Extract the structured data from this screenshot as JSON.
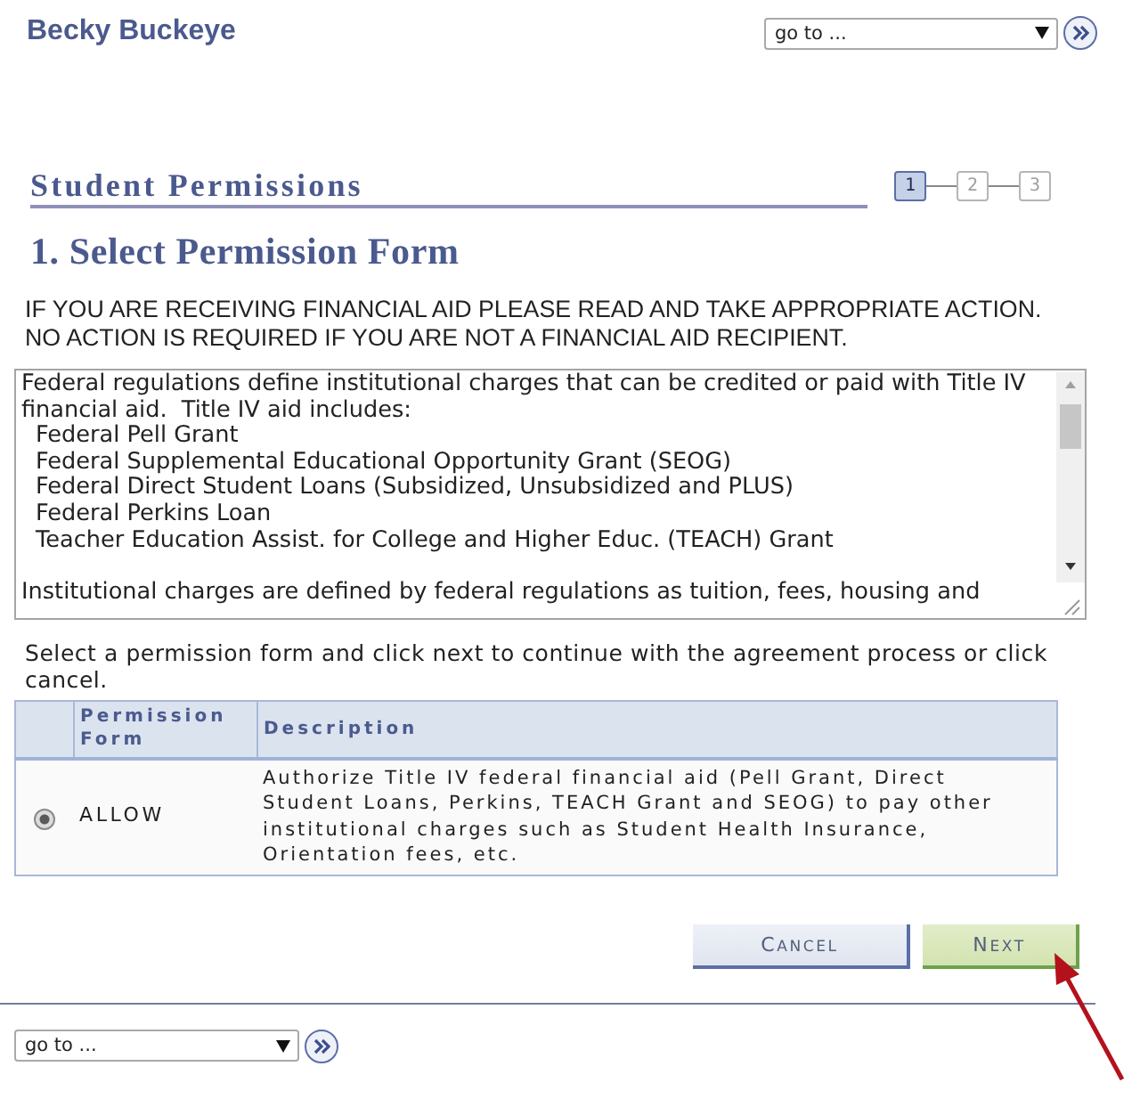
{
  "header": {
    "user_name": "Becky Buckeye",
    "goto": {
      "value": "go to ..."
    }
  },
  "page": {
    "title": "Student Permissions",
    "steps": [
      {
        "label": "1",
        "selected": true
      },
      {
        "label": "2",
        "selected": false
      },
      {
        "label": "3",
        "selected": false
      }
    ],
    "heading": "1. Select Permission Form",
    "notice": [
      "IF YOU ARE RECEIVING FINANCIAL AID PLEASE READ AND TAKE APPROPRIATE ACTION.",
      "NO ACTION IS REQUIRED IF YOU ARE NOT A FINANCIAL AID RECIPIENT."
    ]
  },
  "terms": {
    "intro": "Federal regulations define institutional charges that can be credited or paid with Title IV financial aid.  Title IV aid includes:",
    "items": [
      "Federal Pell Grant",
      "Federal Supplemental Educational Opportunity Grant (SEOG)",
      "Federal Direct Student Loans (Subsidized, Unsubsidized and PLUS)",
      "Federal Perkins Loan",
      "Teacher Education Assist. for College and Higher Educ. (TEACH) Grant"
    ],
    "outro": "Institutional charges are defined by federal regulations as tuition, fees, housing and"
  },
  "instructions": "Select a permission form and click next to continue with the agreement process or click cancel.",
  "table": {
    "columns": [
      "Permission Form",
      "Description"
    ],
    "rows": [
      {
        "selected": true,
        "form": "ALLOW",
        "description": "Authorize Title IV federal financial aid (Pell Grant, Direct Student Loans, Perkins, TEACH Grant and SEOG) to pay other institutional charges such as Student Health Insurance, Orientation fees, etc."
      }
    ]
  },
  "buttons": [
    {
      "label": "CANCEL",
      "kind": "cancel"
    },
    {
      "label": "NEXT",
      "kind": "next"
    }
  ],
  "footer": {
    "goto": {
      "value": "go to ..."
    }
  }
}
